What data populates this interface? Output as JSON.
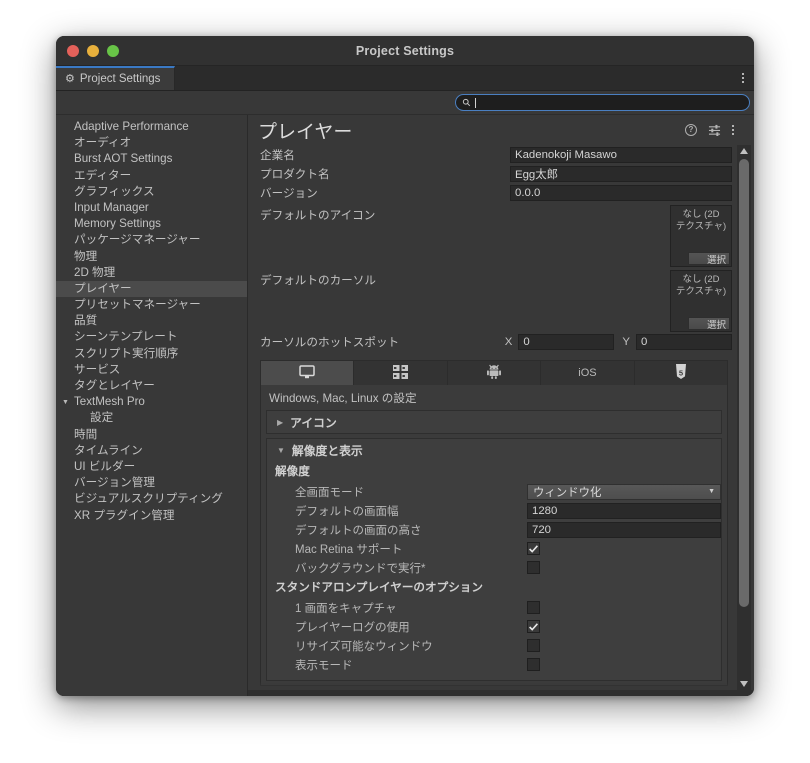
{
  "window": {
    "title": "Project Settings",
    "traffic_lights": [
      "close",
      "minimize",
      "zoom"
    ]
  },
  "editor_tab": {
    "label": "Project Settings",
    "icon": "gear-icon",
    "overflow_icon": "kebab-menu-icon"
  },
  "search": {
    "value": "",
    "placeholder": "",
    "icon": "search-icon"
  },
  "sidebar": {
    "items": [
      {
        "label": "Adaptive Performance",
        "selected": false,
        "child": false,
        "expander": ""
      },
      {
        "label": "オーディオ",
        "selected": false,
        "child": false,
        "expander": ""
      },
      {
        "label": "Burst AOT Settings",
        "selected": false,
        "child": false,
        "expander": ""
      },
      {
        "label": "エディター",
        "selected": false,
        "child": false,
        "expander": ""
      },
      {
        "label": "グラフィックス",
        "selected": false,
        "child": false,
        "expander": ""
      },
      {
        "label": "Input Manager",
        "selected": false,
        "child": false,
        "expander": ""
      },
      {
        "label": "Memory Settings",
        "selected": false,
        "child": false,
        "expander": ""
      },
      {
        "label": "パッケージマネージャー",
        "selected": false,
        "child": false,
        "expander": ""
      },
      {
        "label": "物理",
        "selected": false,
        "child": false,
        "expander": ""
      },
      {
        "label": "2D 物理",
        "selected": false,
        "child": false,
        "expander": ""
      },
      {
        "label": "プレイヤー",
        "selected": true,
        "child": false,
        "expander": ""
      },
      {
        "label": "プリセットマネージャー",
        "selected": false,
        "child": false,
        "expander": ""
      },
      {
        "label": "品質",
        "selected": false,
        "child": false,
        "expander": ""
      },
      {
        "label": "シーンテンプレート",
        "selected": false,
        "child": false,
        "expander": ""
      },
      {
        "label": "スクリプト実行順序",
        "selected": false,
        "child": false,
        "expander": ""
      },
      {
        "label": "サービス",
        "selected": false,
        "child": false,
        "expander": ""
      },
      {
        "label": "タグとレイヤー",
        "selected": false,
        "child": false,
        "expander": ""
      },
      {
        "label": "TextMesh Pro",
        "selected": false,
        "child": false,
        "expander": "▼"
      },
      {
        "label": "設定",
        "selected": false,
        "child": true,
        "expander": ""
      },
      {
        "label": "時間",
        "selected": false,
        "child": false,
        "expander": ""
      },
      {
        "label": "タイムライン",
        "selected": false,
        "child": false,
        "expander": ""
      },
      {
        "label": "UI ビルダー",
        "selected": false,
        "child": false,
        "expander": ""
      },
      {
        "label": "バージョン管理",
        "selected": false,
        "child": false,
        "expander": ""
      },
      {
        "label": "ビジュアルスクリプティング",
        "selected": false,
        "child": false,
        "expander": ""
      },
      {
        "label": "XR プラグイン管理",
        "selected": false,
        "child": false,
        "expander": ""
      }
    ]
  },
  "panel": {
    "title": "プレイヤー",
    "header_icons": [
      "help-icon",
      "preset-icon",
      "kebab-menu-icon"
    ],
    "fields": {
      "company_name": {
        "label": "企業名",
        "value": "Kadenokoji Masawo"
      },
      "product_name": {
        "label": "プロダクト名",
        "value": "Egg太郎"
      },
      "version": {
        "label": "バージョン",
        "value": "0.0.0"
      }
    },
    "default_icon": {
      "label": "デフォルトのアイコン",
      "none_line1": "なし (2D",
      "none_line2": "テクスチャ)",
      "select_button": "選択"
    },
    "default_cursor": {
      "label": "デフォルトのカーソル",
      "none_line1": "なし (2D",
      "none_line2": "テクスチャ)",
      "select_button": "選択"
    },
    "cursor_hotspot": {
      "label": "カーソルのホットスポット",
      "x_label": "X",
      "x_value": "0",
      "y_label": "Y",
      "y_value": "0"
    },
    "platform_tabs": [
      {
        "name": "standalone",
        "icon": "desktop-monitor-icon",
        "label": "",
        "active": true
      },
      {
        "name": "dedicated-server",
        "icon": "server-rack-icon",
        "label": "",
        "active": false
      },
      {
        "name": "android",
        "icon": "android-robot-icon",
        "label": "",
        "active": false
      },
      {
        "name": "ios",
        "icon": "ios-text",
        "label": "iOS",
        "active": false
      },
      {
        "name": "webgl",
        "icon": "html5-shield-icon",
        "label": "",
        "active": false
      }
    ],
    "platform_subtitle": "Windows, Mac, Linux の設定",
    "sections": {
      "icon": {
        "label": "アイコン",
        "expanded": false,
        "triangle": "▶"
      },
      "resolution_display": {
        "label": "解像度と表示",
        "expanded": true,
        "triangle": "▼",
        "groups": [
          {
            "title": "解像度",
            "rows": [
              {
                "label": "全画面モード",
                "type": "dropdown",
                "value": "ウィンドウ化"
              },
              {
                "label": "デフォルトの画面幅",
                "type": "text",
                "value": "1280"
              },
              {
                "label": "デフォルトの画面の高さ",
                "type": "text",
                "value": "720"
              },
              {
                "label": "Mac Retina サポート",
                "type": "checkbox",
                "checked": true
              },
              {
                "label": "バックグラウンドで実行*",
                "type": "checkbox",
                "checked": false
              }
            ]
          },
          {
            "title": "スタンドアロンプレイヤーのオプション",
            "rows": [
              {
                "label": "1 画面をキャプチャ",
                "type": "checkbox",
                "checked": false
              },
              {
                "label": "プレイヤーログの使用",
                "type": "checkbox",
                "checked": true
              },
              {
                "label": "リサイズ可能なウィンドウ",
                "type": "checkbox",
                "checked": false
              },
              {
                "label": "表示モード",
                "type": "checkbox",
                "checked": false
              }
            ]
          }
        ]
      }
    }
  },
  "colors": {
    "window_bg": "#383838",
    "titlebar_bg": "#313131",
    "accent_blue": "#3a79c4",
    "selection": "#4b4b4b",
    "field_bg": "#2a2a2a",
    "text": "#c2c2c2"
  }
}
